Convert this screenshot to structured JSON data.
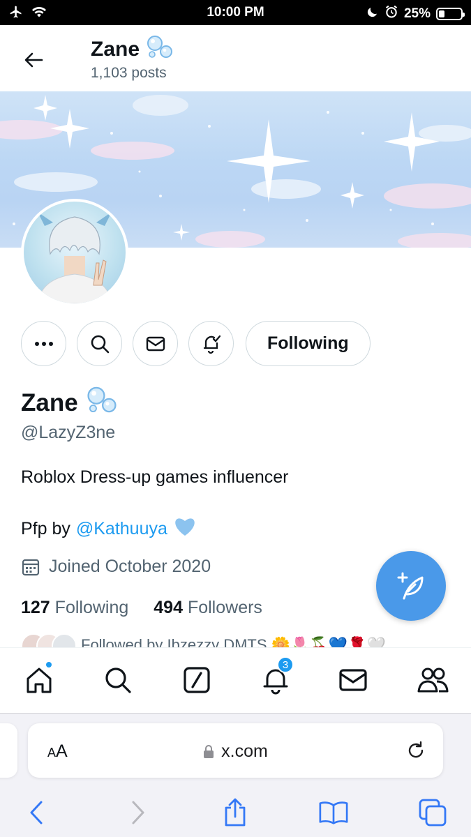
{
  "status_bar": {
    "time": "10:00 PM",
    "battery": "25%"
  },
  "header": {
    "name": "Zane",
    "posts": "1,103 posts"
  },
  "profile": {
    "name": "Zane",
    "handle": "@LazyZ3ne",
    "bio": "Roblox Dress-up games influencer",
    "pfp_prefix": "Pfp by",
    "pfp_link": "@Kathuuya",
    "joined": "Joined October 2020",
    "following_count": "127",
    "following_label": "Following",
    "followers_count": "494",
    "followers_label": "Followers",
    "followed_by": "Followed by Ibzezzy DMTS 🌼🌷🍒💙🌹🤍"
  },
  "actions": {
    "following_button": "Following"
  },
  "bottom_nav": {
    "notifications_badge": "3"
  },
  "safari": {
    "aa_small": "A",
    "aa_large": "A",
    "url": "x.com"
  },
  "colors": {
    "accent": "#1d9bf0",
    "fab": "#4a99e9"
  }
}
